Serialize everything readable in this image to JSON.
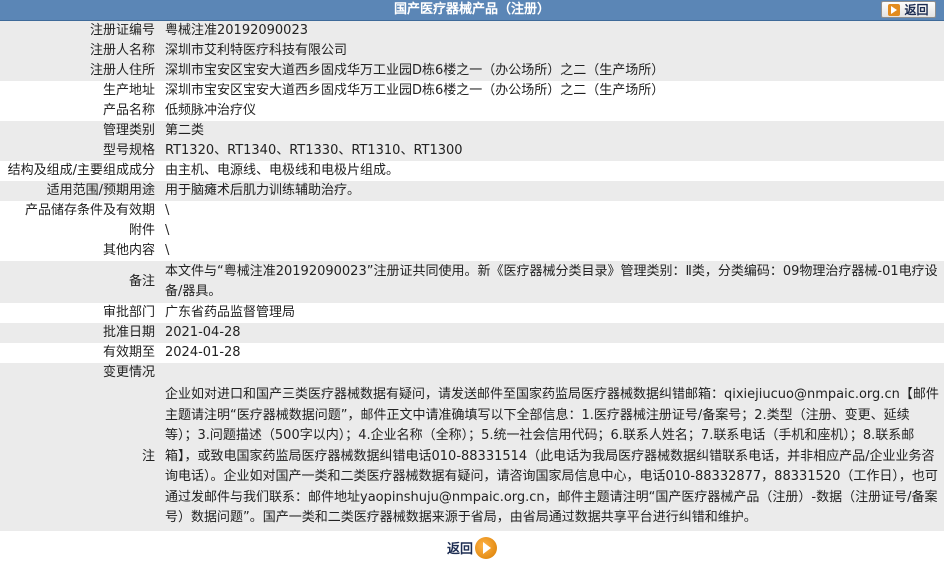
{
  "header": {
    "title": "国产医疗器械产品（注册）",
    "back_label": "返回"
  },
  "rows": [
    {
      "label": "注册证编号",
      "value": "粤械注准20192090023"
    },
    {
      "label": "注册人名称",
      "value": "深圳市艾利特医疗科技有限公司"
    },
    {
      "label": "注册人住所",
      "value": "深圳市宝安区宝安大道西乡固戍华万工业园D栋6楼之一（办公场所）之二（生产场所）"
    },
    {
      "label": "生产地址",
      "value": "深圳市宝安区宝安大道西乡固戍华万工业园D栋6楼之一（办公场所）之二（生产场所）"
    },
    {
      "label": "产品名称",
      "value": "低频脉冲治疗仪"
    },
    {
      "label": "管理类别",
      "value": "第二类"
    },
    {
      "label": "型号规格",
      "value": "RT1320、RT1340、RT1330、RT1310、RT1300"
    },
    {
      "label": "结构及组成/主要组成成分",
      "value": "由主机、电源线、电极线和电极片组成。"
    },
    {
      "label": "适用范围/预期用途",
      "value": "用于脑瘫术后肌力训练辅助治疗。"
    },
    {
      "label": "产品储存条件及有效期",
      "value": "\\"
    },
    {
      "label": "附件",
      "value": "\\"
    },
    {
      "label": "其他内容",
      "value": "\\"
    },
    {
      "label": "备注",
      "value": "本文件与“粤械注准20192090023”注册证共同使用。新《医疗器械分类目录》管理类别：Ⅱ类，分类编码：09物理治疗器械-01电疗设备/器具。"
    },
    {
      "label": "审批部门",
      "value": "广东省药品监督管理局"
    },
    {
      "label": "批准日期",
      "value": "2021-04-28"
    },
    {
      "label": "有效期至",
      "value": "2024-01-28"
    },
    {
      "label": "变更情况",
      "value": ""
    }
  ],
  "note": {
    "label": "注",
    "text": "企业如对进口和国产三类医疗器械数据有疑问，请发送邮件至国家药监局医疗器械数据纠错邮箱：qixiejiucuo@nmpaic.org.cn【邮件主题请注明“医疗器械数据问题”，邮件正文中请准确填写以下全部信息：1.医疗器械注册证号/备案号；2.类型（注册、变更、延续等）；3.问题描述（500字以内）；4.企业名称（全称）；5.统一社会信用代码；6.联系人姓名；7.联系电话（手机和座机）；8.联系邮箱】，或致电国家药监局医疗器械数据纠错电话010-88331514（此电话为我局医疗器械数据纠错联系电话，并非相应产品/企业业务咨询电话）。企业如对国产一类和二类医疗器械数据有疑问，请咨询国家局信息中心，电话010-88332877，88331520（工作日），也可通过发邮件与我们联系：邮件地址yaopinshuju@nmpaic.org.cn，邮件主题请注明“国产医疗器械产品（注册）-数据（注册证号/备案号）数据问题”。国产一类和二类医疗器械数据来源于省局，由省局通过数据共享平台进行纠错和维护。"
  },
  "footer": {
    "back_label": "返回"
  }
}
